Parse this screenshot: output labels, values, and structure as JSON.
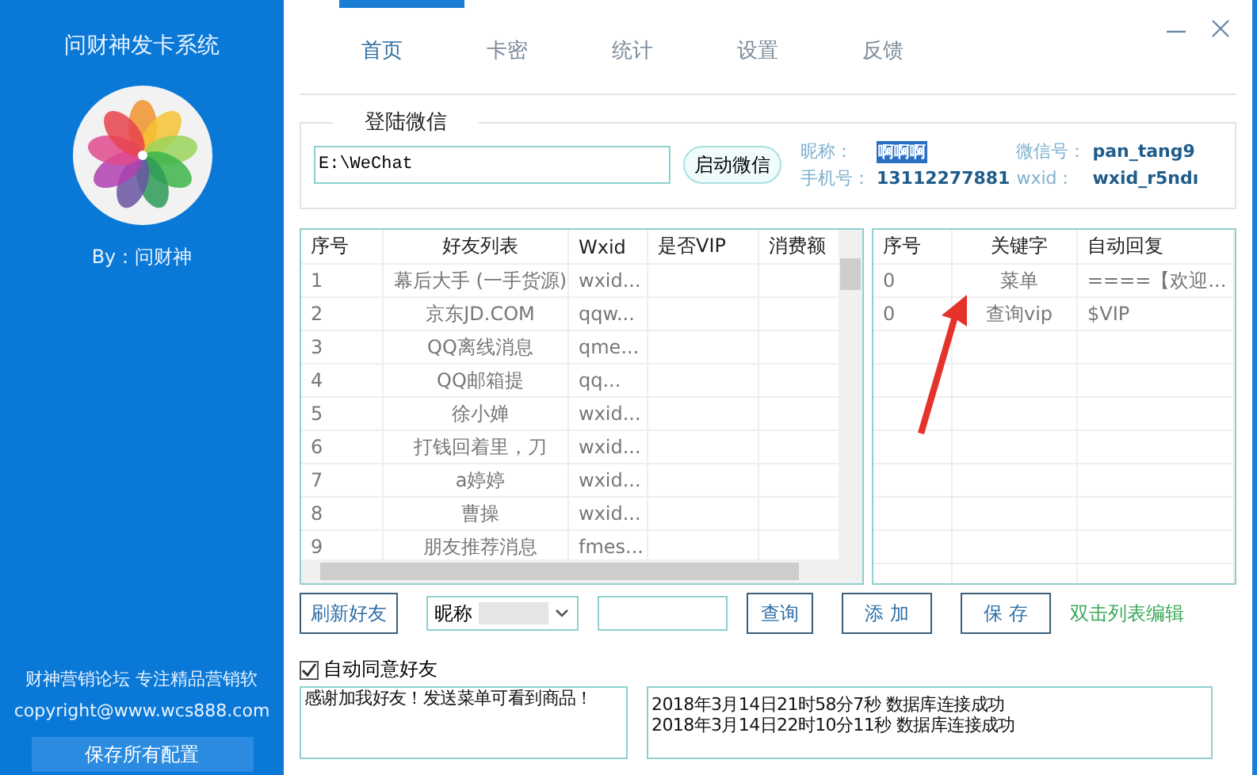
{
  "app": {
    "title": "问财神发卡系统",
    "author": "By：问财神",
    "footer": [
      "财神营销论坛 专注精品营销软",
      "copyright@www.wcs888.com"
    ],
    "save_button": "保存所有配置"
  },
  "tabs": [
    {
      "label": "首页",
      "selected": true
    },
    {
      "label": "卡密",
      "selected": false
    },
    {
      "label": "统计",
      "selected": false
    },
    {
      "label": "设置",
      "selected": false
    },
    {
      "label": "反馈",
      "selected": false
    }
  ],
  "login": {
    "legend": "登陆微信",
    "path": "E:\\WeChat",
    "start_button": "启动微信",
    "nickname_label": "昵称：",
    "nickname": "啊啊啊",
    "wechat_label": "微信号：",
    "wechat": "pan_tang9",
    "phone_label": "手机号：",
    "phone": "13112277881",
    "wxid_label": "wxid：",
    "wxid": "wxid_r5ndı"
  },
  "friends": {
    "columns": [
      "序号",
      "好友列表",
      "Wxid",
      "是否VIP",
      "消费额"
    ],
    "rows": [
      [
        "1",
        "幕后大手 (一手货源)",
        "wxid..."
      ],
      [
        "2",
        "京东JD.COM",
        "qqw..."
      ],
      [
        "3",
        "QQ离线消息",
        "qme..."
      ],
      [
        "4",
        "QQ邮箱提",
        "qq..."
      ],
      [
        "5",
        "徐小婵",
        "wxid..."
      ],
      [
        "6",
        "打钱回着里，刀",
        "wxid..."
      ],
      [
        "7",
        "a婷婷",
        "wxid..."
      ],
      [
        "8",
        "曹操",
        "wxid..."
      ],
      [
        "9",
        "朋友推荐消息",
        "fmes..."
      ]
    ]
  },
  "keywords": {
    "columns": [
      "序号",
      "关键字",
      "自动回复"
    ],
    "rows": [
      [
        "0",
        "菜单",
        "====【欢迎..."
      ],
      [
        "0",
        "查询vip",
        "$VIP"
      ]
    ]
  },
  "controls": {
    "refresh_button": "刷新好友",
    "filter_select": "昵称",
    "query_button": "查询",
    "add_button": "添 加",
    "save_button": "保 存",
    "hint": "双击列表编辑"
  },
  "auto_accept": {
    "label": "自动同意好友",
    "checked": true
  },
  "greeting": "感谢加我好友！发送菜单可看到商品！",
  "log": [
    "2018年3月14日21时58分7秒 数据库连接成功",
    "2018年3月14日22时10分11秒 数据库连接成功"
  ]
}
